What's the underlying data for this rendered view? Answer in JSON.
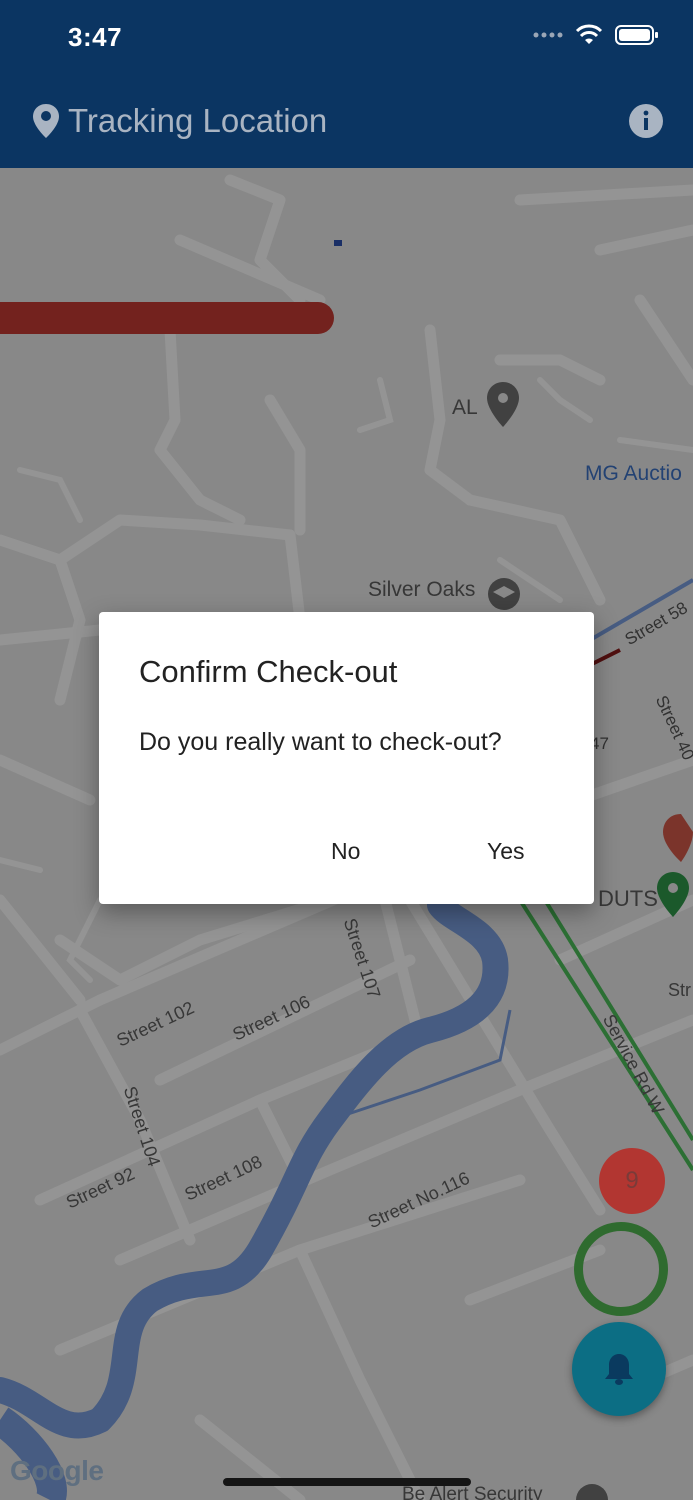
{
  "status_bar": {
    "time": "3:47"
  },
  "app_bar": {
    "title": "Tracking Location"
  },
  "map": {
    "places": {
      "al": "AL",
      "mg_auction": "MG Auctio",
      "silver_oaks": "Silver Oaks",
      "cuts": "DUTS",
      "be_alert": "Be Alert Security"
    },
    "streets": {
      "s58": "Street 58",
      "s40": "Street 40",
      "s47": "47",
      "s107": "Street 107",
      "s102": "Street 102",
      "s106": "Street 106",
      "s104": "Street 104",
      "s92": "Street 92",
      "s108": "Street 108",
      "s116": "Street No.116",
      "service_rd": "Service Rd W",
      "str": "Str"
    }
  },
  "dialog": {
    "title": "Confirm Check-out",
    "message": "Do you really want to check-out?",
    "no_label": "No",
    "yes_label": "Yes"
  },
  "badge_count": "9",
  "google_logo": "Google",
  "colors": {
    "app_bar": "#0b3562",
    "route_red": "#c63b35",
    "river_blue": "#7a9fe0",
    "fab": "#0c6e84",
    "ring_green": "#2f6b2f"
  }
}
